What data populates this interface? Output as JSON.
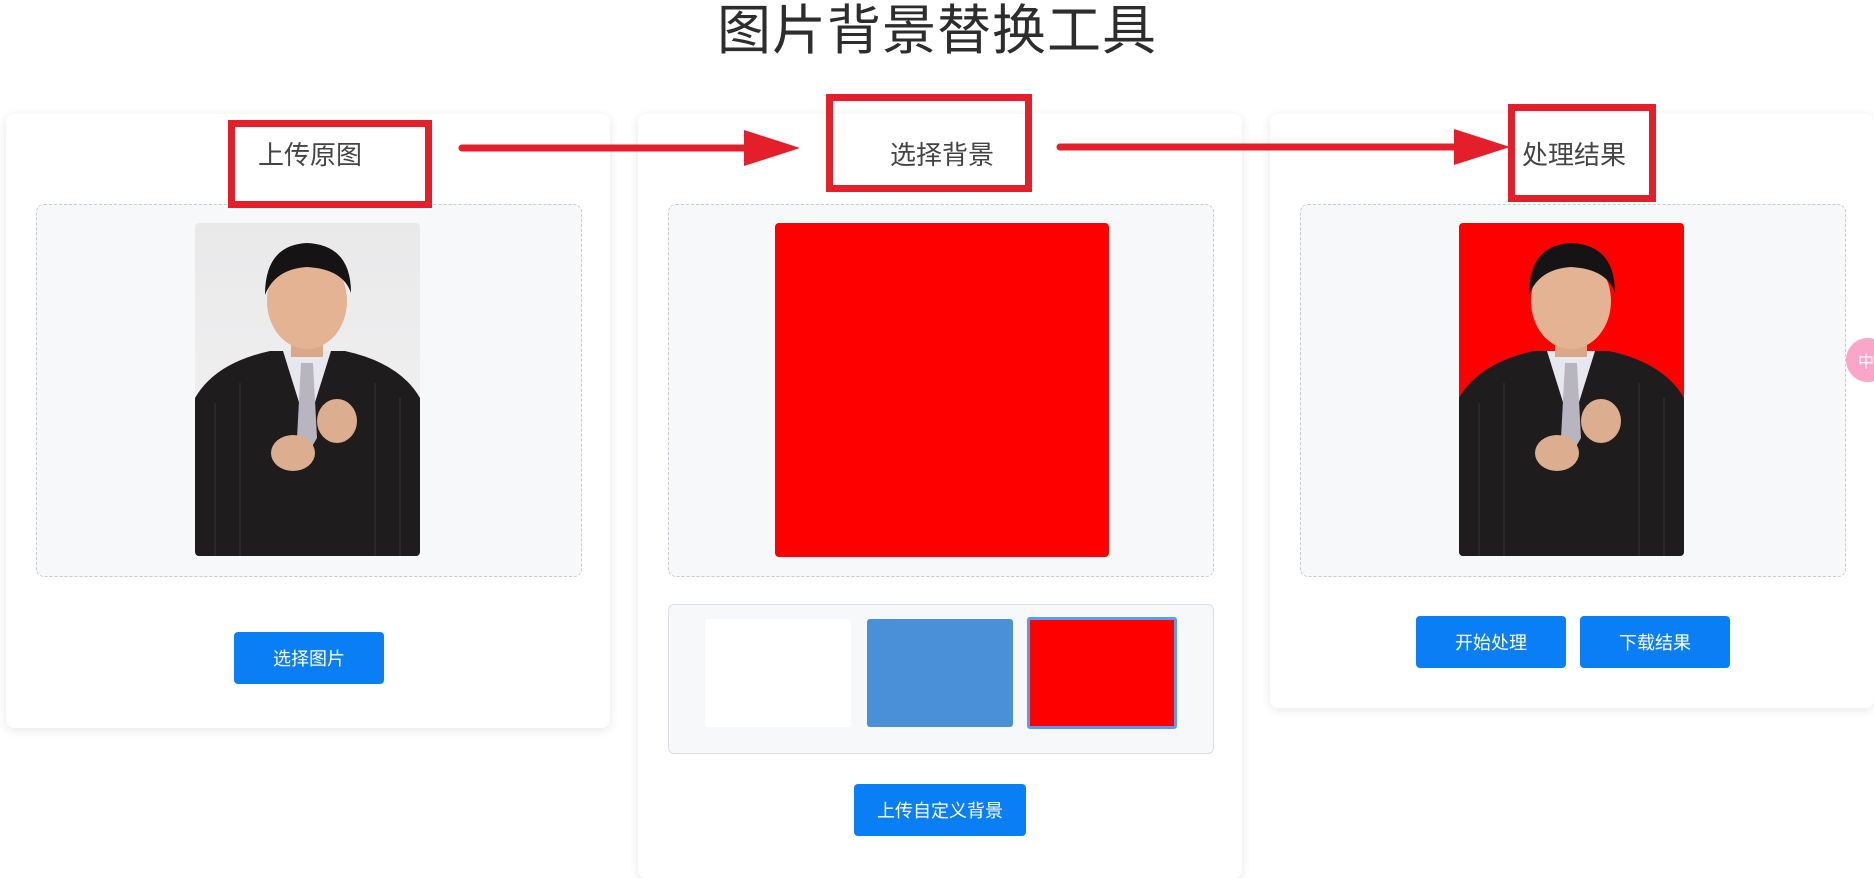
{
  "page": {
    "title": "图片背景替换工具"
  },
  "panels": {
    "upload": {
      "heading": "上传原图",
      "button_label": "选择图片",
      "image_icon": "person-portrait-photo"
    },
    "background": {
      "heading": "选择背景",
      "preview_color": "#ff0000",
      "swatches": [
        {
          "color": "#ffffff",
          "selected": false
        },
        {
          "color": "#4a90d9",
          "selected": false
        },
        {
          "color": "#ff0000",
          "selected": true
        }
      ],
      "upload_button_label": "上传自定义背景"
    },
    "result": {
      "heading": "处理结果",
      "start_button_label": "开始处理",
      "download_button_label": "下载结果",
      "image_icon": "person-portrait-photo-red-bg"
    }
  },
  "side_tab": {
    "label": "中"
  },
  "colors": {
    "accent": "#0a7ff5",
    "annotation_red": "#e41e2b",
    "dropzone_bg": "#f7f8fa"
  },
  "arrow_icons": [
    "right-arrow-icon",
    "right-arrow-icon"
  ]
}
